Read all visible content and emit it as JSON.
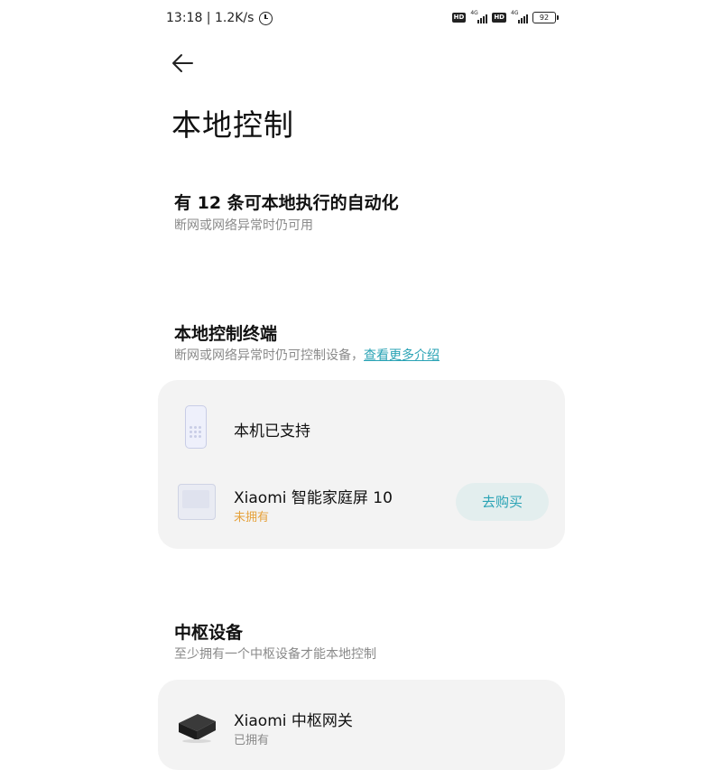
{
  "status_bar": {
    "time_speed": "13:18 | 1.2K/s",
    "sim1_hd": "HD",
    "sim1_net": "4G",
    "sim2_hd": "HD",
    "sim2_net": "4G",
    "battery": "92"
  },
  "header": {
    "title": "本地控制"
  },
  "automation": {
    "title": "有 12 条可本地执行的自动化",
    "subtitle": "断网或网络异常时仍可用"
  },
  "terminal": {
    "title": "本地控制终端",
    "subtitle": "断网或网络异常时仍可控制设备，",
    "link": "查看更多介绍",
    "items": [
      {
        "label": "本机已支持",
        "icon": "phone-icon"
      },
      {
        "label": "Xiaomi 智能家庭屏 10",
        "status": "未拥有",
        "status_color": "#e6a23c",
        "button": "去购买",
        "icon": "smart-display-icon"
      }
    ]
  },
  "hub": {
    "title": "中枢设备",
    "subtitle": "至少拥有一个中枢设备才能本地控制",
    "items": [
      {
        "label": "Xiaomi 中枢网关",
        "status": "已拥有",
        "status_color": "#8a8a8a",
        "icon": "gateway-icon"
      }
    ]
  },
  "colors": {
    "accent": "#2aa3b5",
    "card_bg": "#f3f3f3",
    "warning": "#e6a23c"
  }
}
